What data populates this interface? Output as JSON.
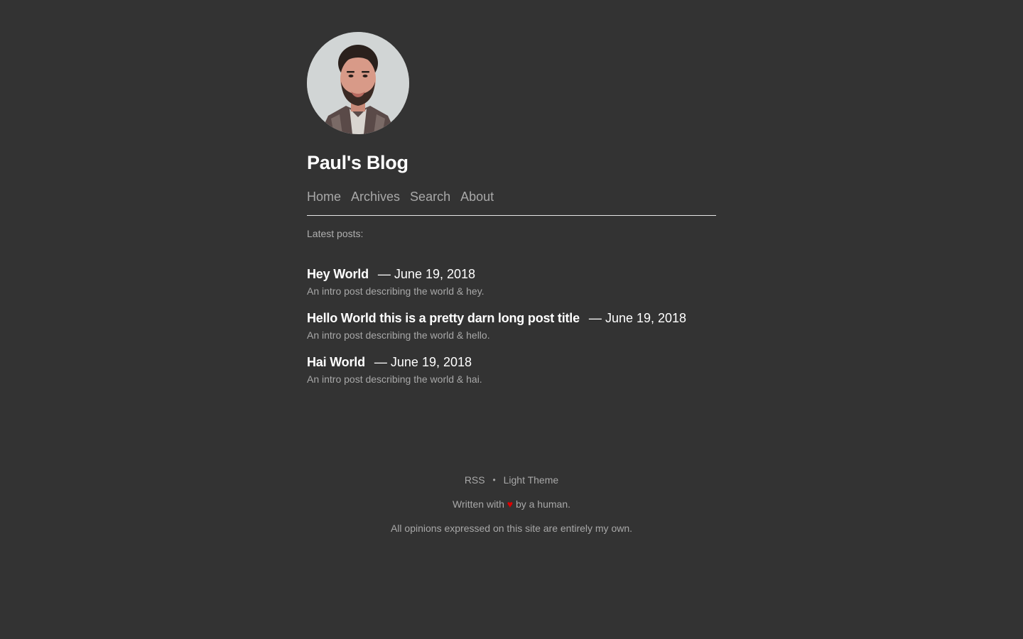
{
  "header": {
    "avatar_alt": "Paul's Blog avatar",
    "site_title": "Paul's Blog"
  },
  "nav": [
    {
      "label": "Home"
    },
    {
      "label": "Archives"
    },
    {
      "label": "Search"
    },
    {
      "label": "About"
    }
  ],
  "main": {
    "latest_label": "Latest posts:",
    "posts": [
      {
        "title": "Hey World",
        "separator": "—",
        "date": "June 19, 2018",
        "description": "An intro post describing the world & hey."
      },
      {
        "title": "Hello World this is a pretty darn long post title",
        "separator": "—",
        "date": "June 19, 2018",
        "description": "An intro post describing the world & hello."
      },
      {
        "title": "Hai World",
        "separator": "—",
        "date": "June 19, 2018",
        "description": "An intro post describing the world & hai."
      }
    ]
  },
  "footer": {
    "rss_label": "RSS",
    "bullet": "•",
    "theme_label": "Light Theme",
    "written_prefix": "Written with",
    "heart": "♥",
    "written_suffix": "by a human.",
    "disclaimer": "All opinions expressed on this site are entirely my own."
  },
  "colors": {
    "background": "#333333",
    "title": "#ffffff",
    "muted_text": "#a8a8a8",
    "heart": "#e00000"
  }
}
